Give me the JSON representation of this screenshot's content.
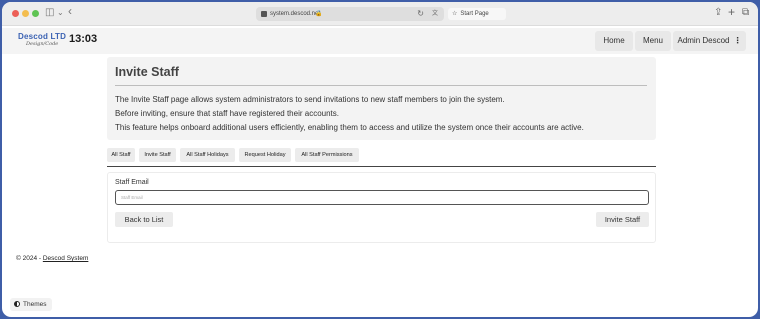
{
  "browser": {
    "url": "system.descod.net",
    "lock_icon": "🔒",
    "tab_label": "Start Page",
    "star_icon": "☆",
    "sidebar_icon": "◫",
    "chevron_icon": "⌄",
    "back_icon": "‹",
    "reload_icon": "↻",
    "translate_icon": "文",
    "share_icon": "⇪",
    "new_tab_icon": "+",
    "tabs_icon": "⧉",
    "colors": {
      "red": "#ec5f57",
      "yellow": "#f3bd4f",
      "green": "#5fc454"
    }
  },
  "navbar": {
    "logo_top": "Descod LTD",
    "logo_bottom": "Design/Code",
    "clock": "13:03",
    "home_label": "Home",
    "menu_label": "Menu",
    "admin_label": "Admin Descod",
    "kebab_icon": "⋮"
  },
  "info": {
    "title": "Invite Staff",
    "line1": "The Invite Staff page allows system administrators to send invitations to new staff members to join the system.",
    "line2": "Before inviting, ensure that staff have registered their accounts.",
    "line3": "This feature helps onboard additional users efficiently, enabling them to access and utilize the system once their accounts are active."
  },
  "tabs": {
    "all_staff": "All Staff",
    "invite_staff": "Invite Staff",
    "all_staff_holidays": "All Staff Holidays",
    "request_holiday": "Request Holiday",
    "all_staff_permissions": "All Staff Permissions"
  },
  "form": {
    "email_label": "Staff Email",
    "email_placeholder": "Staff Email",
    "email_value": "",
    "back_label": "Back to List",
    "invite_label": "Invite Staff"
  },
  "footer": {
    "prefix": "© 2024 - ",
    "link": "Descod System"
  },
  "themes": {
    "label": "Themes"
  }
}
